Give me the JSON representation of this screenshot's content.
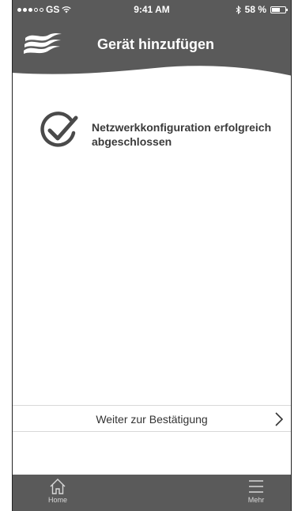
{
  "status_bar": {
    "carrier": "GS",
    "time": "9:41 AM",
    "battery_text": "58 %",
    "battery_level": 0.58
  },
  "header": {
    "title": "Gerät hinzufügen",
    "logo_icon": "waves-logo"
  },
  "content": {
    "status_icon": "check-circle-icon",
    "message": "Netzwerkkonfiguration erfolgreich abgeschlossen"
  },
  "action": {
    "next_label": "Weiter zur Bestätigung",
    "next_icon": "chevron-right-icon"
  },
  "tabbar": {
    "home_label": "Home",
    "more_label": "Mehr"
  },
  "colors": {
    "header_bg": "#5a5a5a",
    "tabbar_bg": "#5a5a5a",
    "text": "#3a3a3a"
  }
}
